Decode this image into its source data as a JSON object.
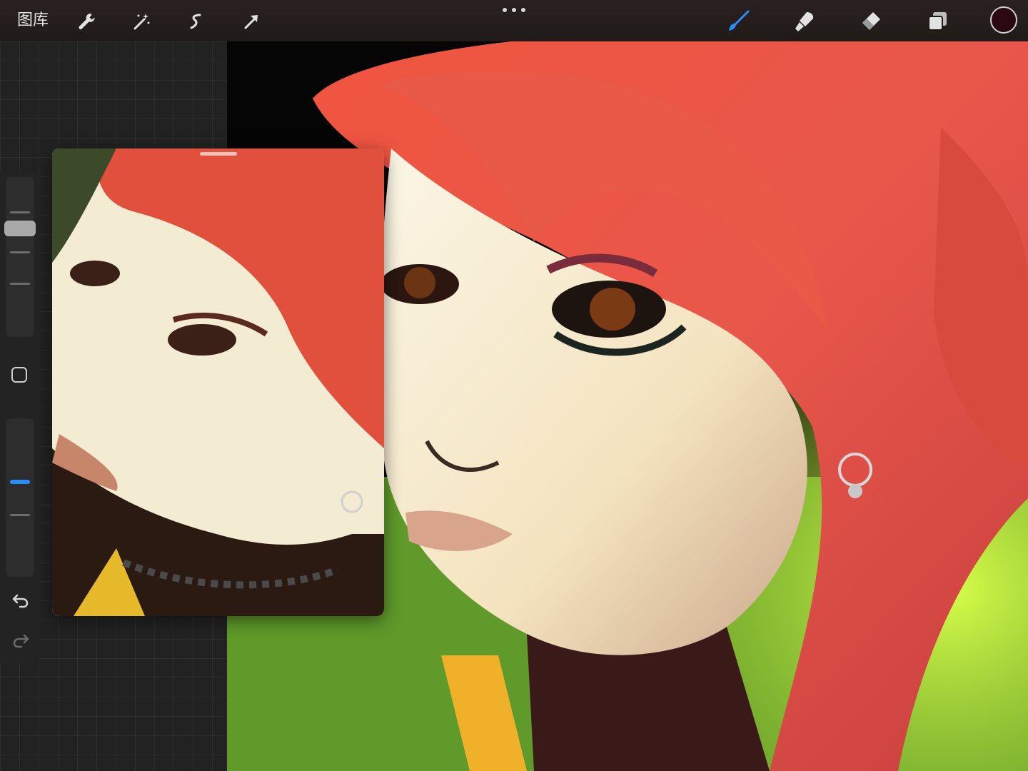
{
  "toolbar": {
    "gallery_label": "图库",
    "left_tools": [
      "wrench-icon",
      "magic-wand-icon",
      "selection-icon",
      "transform-arrow-icon"
    ],
    "right_tools": [
      "brush-icon",
      "smudge-icon",
      "eraser-icon",
      "layers-icon"
    ],
    "active_tool": "brush-icon",
    "active_color": "#2a0a10",
    "accent_color": "#2b8cf5"
  },
  "sidebar": {
    "brush_size_level": 0.7,
    "opacity_level": 0.6,
    "undo_icon": "undo-icon",
    "redo_icon": "redo-icon"
  }
}
